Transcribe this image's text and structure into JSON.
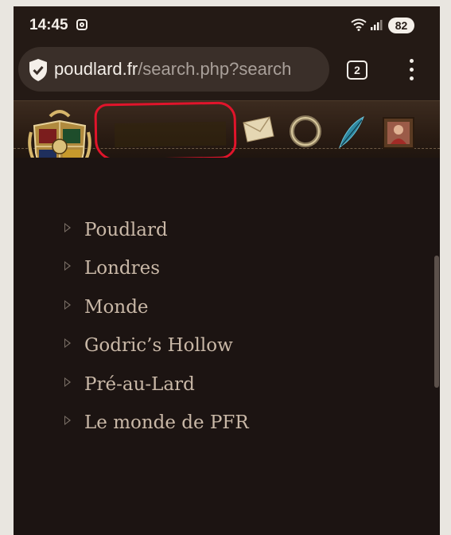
{
  "status_bar": {
    "time": "14:45",
    "battery": "82",
    "icons": [
      "instagram-icon",
      "wifi-icon",
      "signal-icon"
    ]
  },
  "browser": {
    "url_domain": "poudlard.fr",
    "url_path": "/search.php?search",
    "tab_count": "2",
    "icons": [
      "shield-icon",
      "menu-icon"
    ]
  },
  "site_header": {
    "icons": [
      "hogwarts-crest-icon",
      "envelope-icon",
      "ring-icon",
      "quill-icon",
      "portrait-icon"
    ],
    "highlight_color": "#e1142b"
  },
  "menu": {
    "items": [
      {
        "label": "Poudlard"
      },
      {
        "label": "Londres"
      },
      {
        "label": "Monde"
      },
      {
        "label": "Godric’s Hollow"
      },
      {
        "label": "Pré-au-Lard"
      },
      {
        "label": "Le monde de PFR"
      }
    ]
  },
  "colors": {
    "background": "#1c1412",
    "menu_text": "#c9b8a7",
    "header": "#3c2b1f"
  }
}
